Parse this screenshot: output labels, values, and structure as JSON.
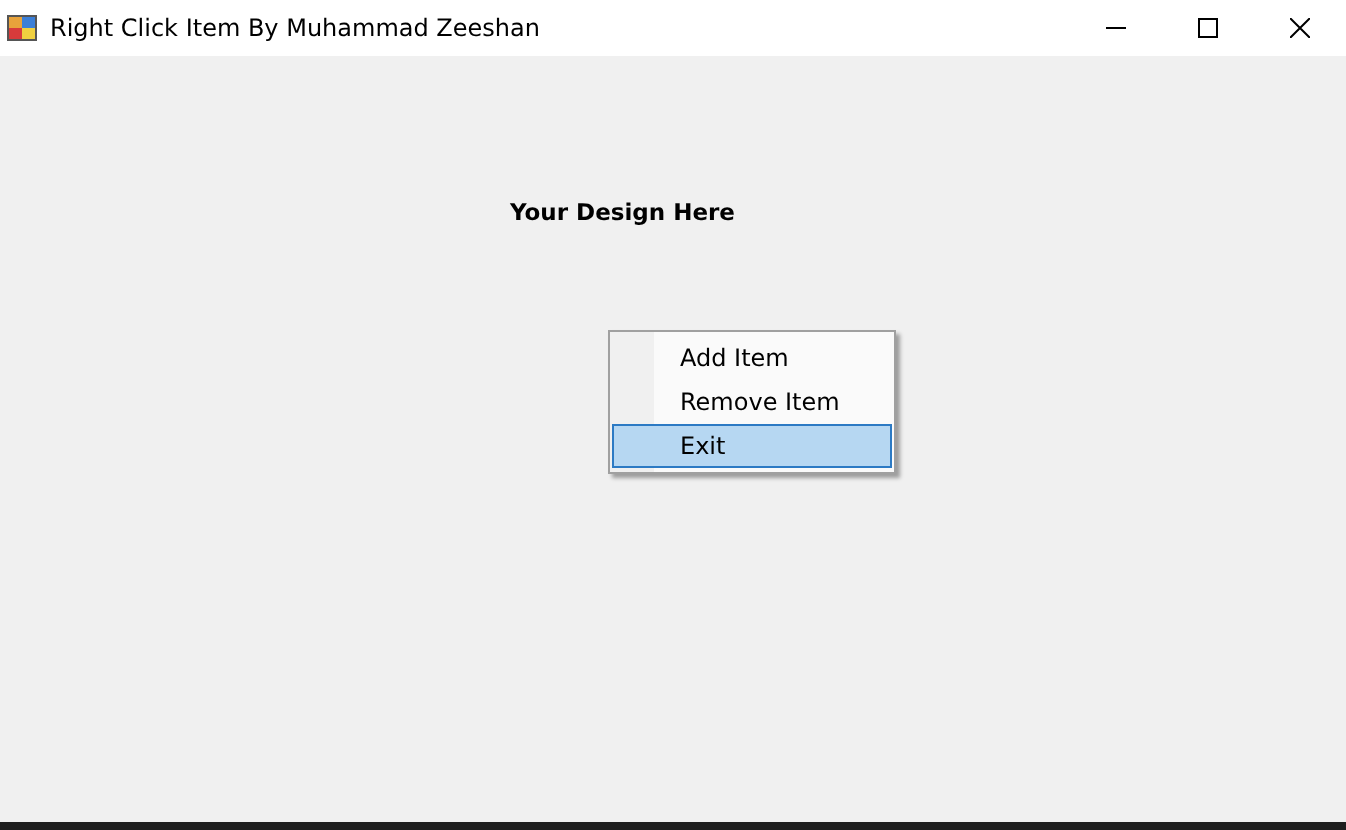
{
  "window": {
    "title": "Right Click Item By Muhammad Zeeshan"
  },
  "form": {
    "label": "Your Design Here"
  },
  "context_menu": {
    "items": [
      {
        "label": "Add Item",
        "selected": false
      },
      {
        "label": "Remove Item",
        "selected": false
      },
      {
        "label": "Exit",
        "selected": true
      }
    ]
  }
}
